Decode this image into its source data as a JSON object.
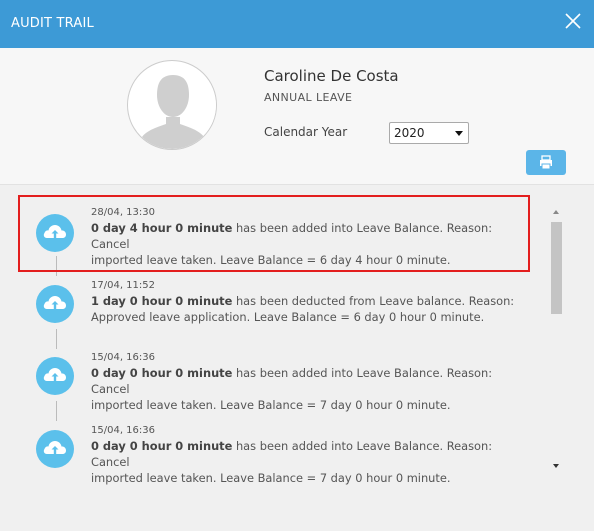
{
  "header": {
    "title": "AUDIT TRAIL",
    "close_icon": "close-icon"
  },
  "profile": {
    "name": "Caroline De Costa",
    "leave_type": "ANNUAL LEAVE",
    "year_label": "Calendar Year",
    "year_value": "2020",
    "print_icon": "printer-icon"
  },
  "entries": [
    {
      "time": "28/04, 13:30",
      "bold": "0 day 4 hour 0 minute",
      "text1": " has been added into Leave Balance. Reason: Cancel",
      "text2": "imported leave taken. Leave Balance = 6 day 4 hour 0 minute."
    },
    {
      "time": "17/04, 11:52",
      "bold": "1 day 0 hour 0 minute",
      "text1": " has been deducted from Leave balance. Reason:",
      "text2": "Approved leave application. Leave Balance = 6 day 0 hour 0 minute."
    },
    {
      "time": "15/04, 16:36",
      "bold": "0 day 0 hour 0 minute",
      "text1": " has been added into Leave Balance. Reason: Cancel",
      "text2": "imported leave taken. Leave Balance = 7 day 0 hour 0 minute."
    },
    {
      "time": "15/04, 16:36",
      "bold": "0 day 0 hour 0 minute",
      "text1": " has been added into Leave Balance. Reason: Cancel",
      "text2": "imported leave taken. Leave Balance = 7 day 0 hour 0 minute."
    }
  ],
  "colors": {
    "header": "#3d9ad6",
    "icon": "#5bc0eb",
    "print_button": "#5bb5e8",
    "highlight": "#e31e1e"
  }
}
